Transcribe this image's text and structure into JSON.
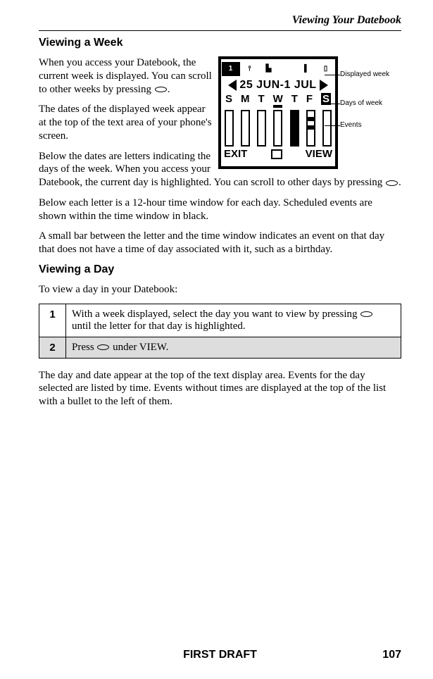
{
  "header": {
    "chapter": "Viewing Your Datebook"
  },
  "section1": {
    "heading": "Viewing a Week",
    "p1a": "When you access your Datebook, the current week is displayed. You can scroll to other weeks by pressing ",
    "p1b": ".",
    "p2": "The dates of the displayed week appear at the top of the text area of your phone's screen.",
    "p3a": "Below the dates are letters indicating the days of the week. When you access your Datebook, the current day is highlighted. You can scroll to other days by pressing ",
    "p3b": ".",
    "p4": "Below each letter is a 12-hour time window for each day. Scheduled events are shown within the time window in black.",
    "p5": "A small bar between the letter and the time window indicates an event on that day that does not have a time of day associated with it, such as a birthday."
  },
  "figure": {
    "icon1": "1",
    "weekdate": "25 JUN-1 JUL",
    "days": [
      "S",
      "M",
      "T",
      "W",
      "T",
      "F",
      "S"
    ],
    "softkey_left": "EXIT",
    "softkey_right": "VIEW",
    "callout1": "Displayed week",
    "callout2": "Days of week",
    "callout3": "Events"
  },
  "section2": {
    "heading": "Viewing a Day",
    "intro": "To view a day in your Datebook:",
    "step1_num": "1",
    "step1a": "With a week displayed, select the day you want to view by pressing ",
    "step1b": " until the letter for that day is highlighted.",
    "step2_num": "2",
    "step2a": "Press ",
    "step2b": " under VIEW.",
    "after": "The day and date appear at the top of the text display area. Events for the day selected are listed by time. Events without times are displayed at the top of the list with a bullet to the left of them."
  },
  "footer": {
    "draft": "FIRST DRAFT",
    "page": "107"
  }
}
